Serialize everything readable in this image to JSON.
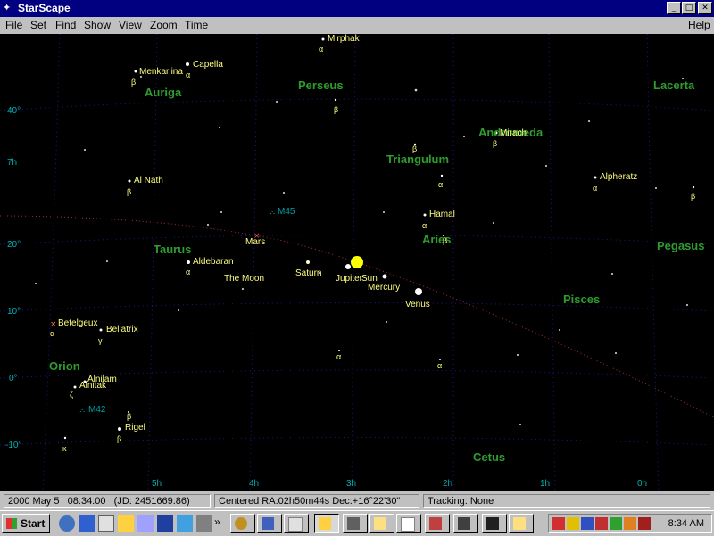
{
  "window": {
    "title": "StarScape",
    "min": "_",
    "max": "□",
    "close": "✕"
  },
  "menu": {
    "file": "File",
    "set": "Set",
    "find": "Find",
    "show": "Show",
    "view": "View",
    "zoom": "Zoom",
    "time": "Time",
    "help": "Help"
  },
  "constellations": {
    "auriga": "Auriga",
    "perseus": "Perseus",
    "lacerta": "Lacerta",
    "andromeda": "Andromeda",
    "triangulum": "Triangulum",
    "taurus": "Taurus",
    "aries": "Aries",
    "pegasus": "Pegasus",
    "pisces": "Pisces",
    "orion": "Orion",
    "cetus": "Cetus"
  },
  "stars": {
    "mirphak": "Mirphak",
    "menkarlina": "Menkarlina",
    "capella": "Capella",
    "mirach": "Mirach",
    "alnath": "Al Nath",
    "alpheratz": "Alpheratz",
    "hamal": "Hamal",
    "aldebaran": "Aldebaran",
    "betelgeux": "Betelgeux",
    "bellatrix": "Bellatrix",
    "alnitak": "Alnitak",
    "alnilam": "Alnilam",
    "rigel": "Rigel"
  },
  "greek": {
    "alpha": "α",
    "beta": "β",
    "gamma": "γ",
    "zeta": "ζ",
    "kappa": "κ"
  },
  "planets": {
    "mars": "Mars",
    "saturn": "Saturn",
    "moon": "The Moon",
    "jupiter": "Jupiter",
    "sun": "Sun",
    "mercury": "Mercury",
    "venus": "Venus"
  },
  "deepsky": {
    "m45": "M45",
    "m42": "M42"
  },
  "axis": {
    "dec": [
      "40°",
      "20°",
      "10°",
      "0°",
      "-10°"
    ],
    "ra_left": "7h",
    "ra": [
      "5h",
      "4h",
      "3h",
      "2h",
      "1h",
      "0h"
    ]
  },
  "status": {
    "date": "2000 May 5",
    "time": "08:34:00",
    "jd": "(JD: 2451669.86)",
    "centered": "Centered  RA:02h50m44s  Dec:+16°22'30\"",
    "tracking": "Tracking: None"
  },
  "taskbar": {
    "start": "Start",
    "chevron": "»",
    "clock": "8:34 AM"
  },
  "colors": {
    "sky": "#000000",
    "constellation": "#2e9d2e",
    "star": "#ffff80",
    "grid": "#1a1a8c",
    "ecliptic": "#a03030",
    "sun": "#ffff00",
    "titlebar": "#000080"
  }
}
